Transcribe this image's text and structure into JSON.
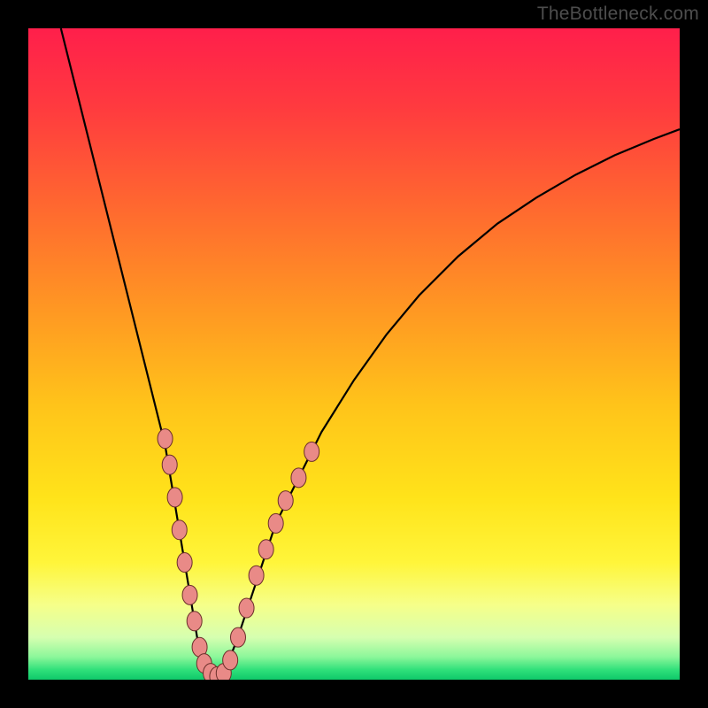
{
  "watermark": "TheBottleneck.com",
  "colors": {
    "frame": "#000000",
    "gradient_stops": [
      {
        "offset": 0.0,
        "color": "#ff1f4b"
      },
      {
        "offset": 0.12,
        "color": "#ff3a3f"
      },
      {
        "offset": 0.28,
        "color": "#ff6a2f"
      },
      {
        "offset": 0.44,
        "color": "#ff9a22"
      },
      {
        "offset": 0.58,
        "color": "#ffc41a"
      },
      {
        "offset": 0.72,
        "color": "#ffe31a"
      },
      {
        "offset": 0.82,
        "color": "#fff53a"
      },
      {
        "offset": 0.885,
        "color": "#f6ff89"
      },
      {
        "offset": 0.935,
        "color": "#d6ffb0"
      },
      {
        "offset": 0.965,
        "color": "#8cf79a"
      },
      {
        "offset": 0.985,
        "color": "#2fe07a"
      },
      {
        "offset": 1.0,
        "color": "#0fc96a"
      }
    ],
    "curve": "#000000",
    "marker_fill": "#e98a87",
    "marker_stroke": "#6b2f2a"
  },
  "chart_data": {
    "type": "line",
    "title": "",
    "xlabel": "",
    "ylabel": "",
    "xlim": [
      0,
      100
    ],
    "ylim": [
      0,
      100
    ],
    "legend": false,
    "grid": false,
    "series": [
      {
        "name": "bottleneck-curve",
        "x": [
          5,
          7,
          9,
          11,
          13,
          15,
          17,
          19,
          21,
          23,
          24,
          25,
          26,
          27,
          28,
          29,
          30,
          32,
          34,
          36,
          38,
          41,
          45,
          50,
          55,
          60,
          66,
          72,
          78,
          84,
          90,
          96,
          100
        ],
        "y": [
          100,
          92,
          84,
          76,
          68,
          60,
          52,
          44,
          36,
          24,
          18,
          12,
          6,
          3,
          1,
          0,
          1,
          6,
          12,
          18,
          24,
          30,
          38,
          46,
          53,
          59,
          65,
          70,
          74,
          77.5,
          80.5,
          83,
          84.5
        ]
      }
    ],
    "markers": [
      {
        "x": 21.0,
        "y": 37
      },
      {
        "x": 21.7,
        "y": 33
      },
      {
        "x": 22.5,
        "y": 28
      },
      {
        "x": 23.2,
        "y": 23
      },
      {
        "x": 24.0,
        "y": 18
      },
      {
        "x": 24.8,
        "y": 13
      },
      {
        "x": 25.5,
        "y": 9
      },
      {
        "x": 26.3,
        "y": 5
      },
      {
        "x": 27.0,
        "y": 2.5
      },
      {
        "x": 28.0,
        "y": 1
      },
      {
        "x": 29.0,
        "y": 0.5
      },
      {
        "x": 30.0,
        "y": 1
      },
      {
        "x": 31.0,
        "y": 3
      },
      {
        "x": 32.2,
        "y": 6.5
      },
      {
        "x": 33.5,
        "y": 11
      },
      {
        "x": 35.0,
        "y": 16
      },
      {
        "x": 36.5,
        "y": 20
      },
      {
        "x": 38.0,
        "y": 24
      },
      {
        "x": 39.5,
        "y": 27.5
      },
      {
        "x": 41.5,
        "y": 31
      },
      {
        "x": 43.5,
        "y": 35
      }
    ]
  }
}
